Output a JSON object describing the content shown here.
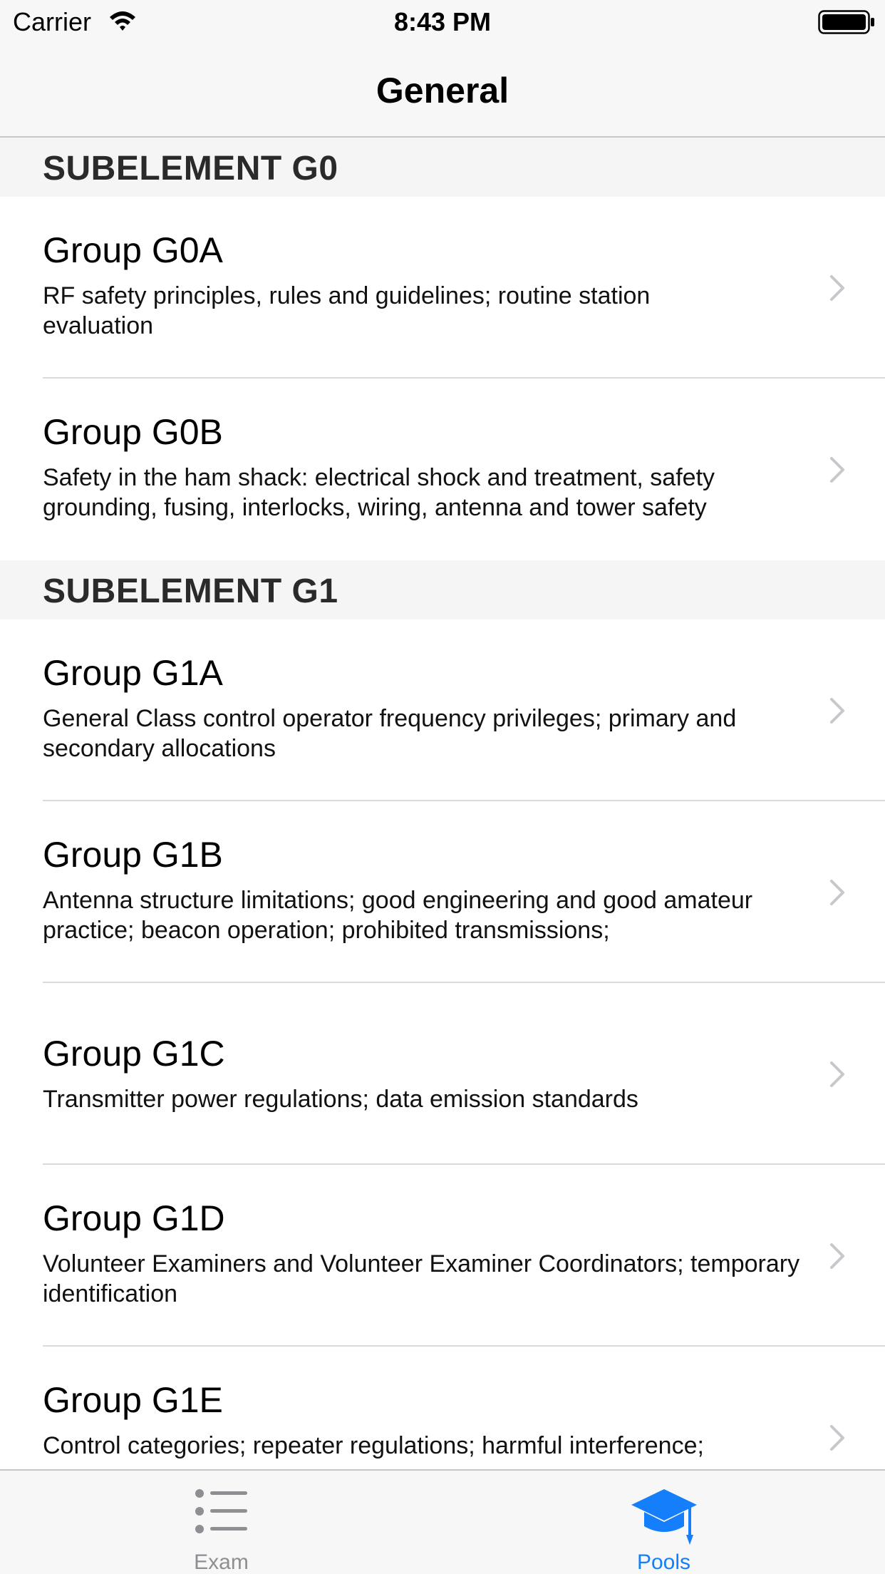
{
  "status_bar": {
    "carrier": "Carrier",
    "time": "8:43 PM",
    "wifi_icon": "wifi-icon",
    "battery_icon": "battery-icon"
  },
  "nav": {
    "title": "General"
  },
  "sections": [
    {
      "header": "SUBELEMENT G0",
      "rows": [
        {
          "title": "Group G0A",
          "subtitle": "RF safety principles, rules and guidelines; routine station evaluation",
          "chevron": "chevron-right-icon"
        },
        {
          "title": "Group G0B",
          "subtitle": "Safety in the ham shack: electrical shock and treatment, safety grounding, fusing, interlocks, wiring, antenna and tower safety",
          "chevron": "chevron-right-icon"
        }
      ]
    },
    {
      "header": "SUBELEMENT G1",
      "rows": [
        {
          "title": "Group G1A",
          "subtitle": "General Class control operator frequency privileges; primary and secondary allocations",
          "chevron": "chevron-right-icon"
        },
        {
          "title": "Group G1B",
          "subtitle": "Antenna structure limitations; good engineering and good amateur practice; beacon operation; prohibited transmissions;",
          "chevron": "chevron-right-icon"
        },
        {
          "title": "Group G1C",
          "subtitle": "Transmitter power regulations; data emission standards",
          "chevron": "chevron-right-icon"
        },
        {
          "title": "Group G1D",
          "subtitle": "Volunteer Examiners and Volunteer Examiner Coordinators; temporary identification",
          "chevron": "chevron-right-icon"
        },
        {
          "title": "Group G1E",
          "subtitle": "Control categories; repeater regulations; harmful interference;",
          "chevron": "chevron-right-icon"
        }
      ]
    }
  ],
  "tab_bar": {
    "tabs": [
      {
        "label": "Exam",
        "icon": "list-icon",
        "selected": false
      },
      {
        "label": "Pools",
        "icon": "graduation-cap-icon",
        "selected": true
      }
    ]
  },
  "colors": {
    "accent": "#147efb",
    "inactive_tab": "#8e8e93",
    "bar_background": "#f7f7f7",
    "section_background": "#f5f5f5",
    "separator": "#dadadc",
    "chevron": "#c7c7cc"
  }
}
